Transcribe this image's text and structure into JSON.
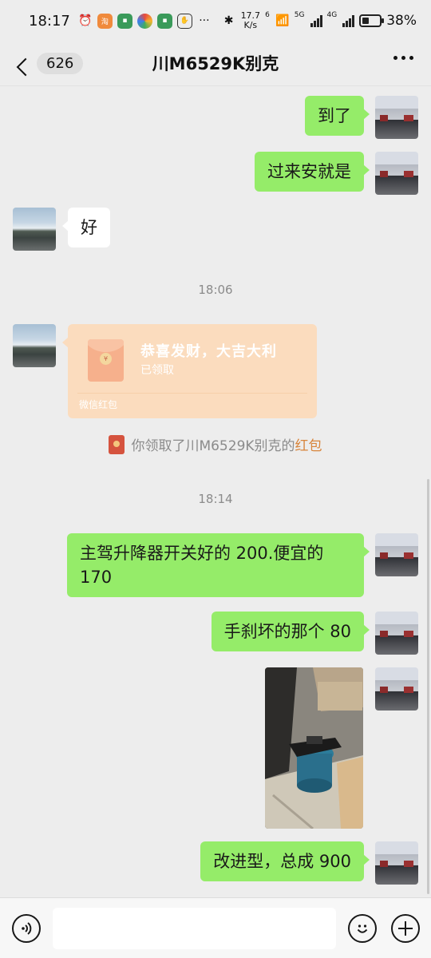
{
  "status_bar": {
    "time": "18:17",
    "speed_value": "17.7",
    "speed_unit": "K/s",
    "net_6": "6",
    "net_5g": "5G",
    "net_4g": "4G",
    "battery": "38%",
    "icons": [
      "alarm-icon",
      "taobao-icon",
      "bank-app-icon",
      "photos-icon",
      "bank-app-icon",
      "assist-icon",
      "more-notifications-icon",
      "bluetooth-icon",
      "wifi-icon",
      "signal-icon",
      "battery-icon"
    ]
  },
  "nav": {
    "unread_count": "626",
    "title": "川M6529K别克"
  },
  "messages": {
    "m1": "到了",
    "m2": "过来安就是",
    "m3": "好",
    "time1": "18:06",
    "redpacket": {
      "title": "恭喜发财，大吉大利",
      "status": "已领取",
      "footer": "微信红包",
      "seal": "¥"
    },
    "sys_notice": {
      "prefix": "你领取了川M6529K别克的",
      "link": "红包"
    },
    "time2": "18:14",
    "m4": "主驾升降器开关好的 200.便宜的 170",
    "m5": "手刹坏的那个 80",
    "m6": "改进型，总成 900"
  },
  "colors": {
    "sent_bubble": "#95ec69",
    "received_bubble": "#ffffff",
    "background": "#ededed",
    "redpacket": "#fbdcbe",
    "link": "#d8853c"
  },
  "input_bar": {
    "text_value": ""
  }
}
